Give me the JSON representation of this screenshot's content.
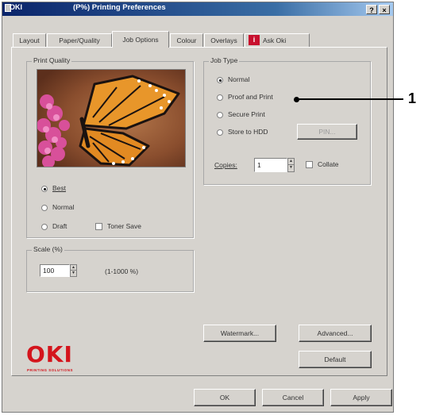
{
  "window": {
    "title_brand": "OKI",
    "title": "(P%) Printing Preferences",
    "help_button": "?",
    "close_button": "×"
  },
  "tabs": [
    {
      "label": "Layout"
    },
    {
      "label": "Paper/Quality"
    },
    {
      "label": "Job Options",
      "active": true
    },
    {
      "label": "Colour"
    },
    {
      "label": "Overlays"
    },
    {
      "label": "Ask Oki"
    }
  ],
  "print_quality": {
    "group_label": "Print Quality",
    "options": [
      "Best",
      "Normal",
      "Draft"
    ],
    "selected": "Best",
    "toner_save_label": "Toner Save",
    "toner_save_checked": false
  },
  "scaling": {
    "group_label": "Scale (%)",
    "value": "100",
    "range_text": "(1-1000 %)"
  },
  "job_type": {
    "group_label": "Job Type",
    "options": [
      "Normal",
      "Proof and Print",
      "Secure Print",
      "Store to HDD"
    ],
    "selected": "Normal",
    "pin_button": "PIN...",
    "copies_label": "Copies:",
    "copies_value": "1",
    "collate_label": "Collate",
    "collate_checked": false
  },
  "buttons": {
    "watermark": "Watermark...",
    "advanced": "Advanced...",
    "default": "Default",
    "ok": "OK",
    "cancel": "Cancel",
    "apply": "Apply"
  },
  "logo": {
    "text": "OKI",
    "tagline": "PRINTING SOLUTIONS",
    "color": "#d4141c"
  },
  "callout": {
    "number": "1"
  }
}
